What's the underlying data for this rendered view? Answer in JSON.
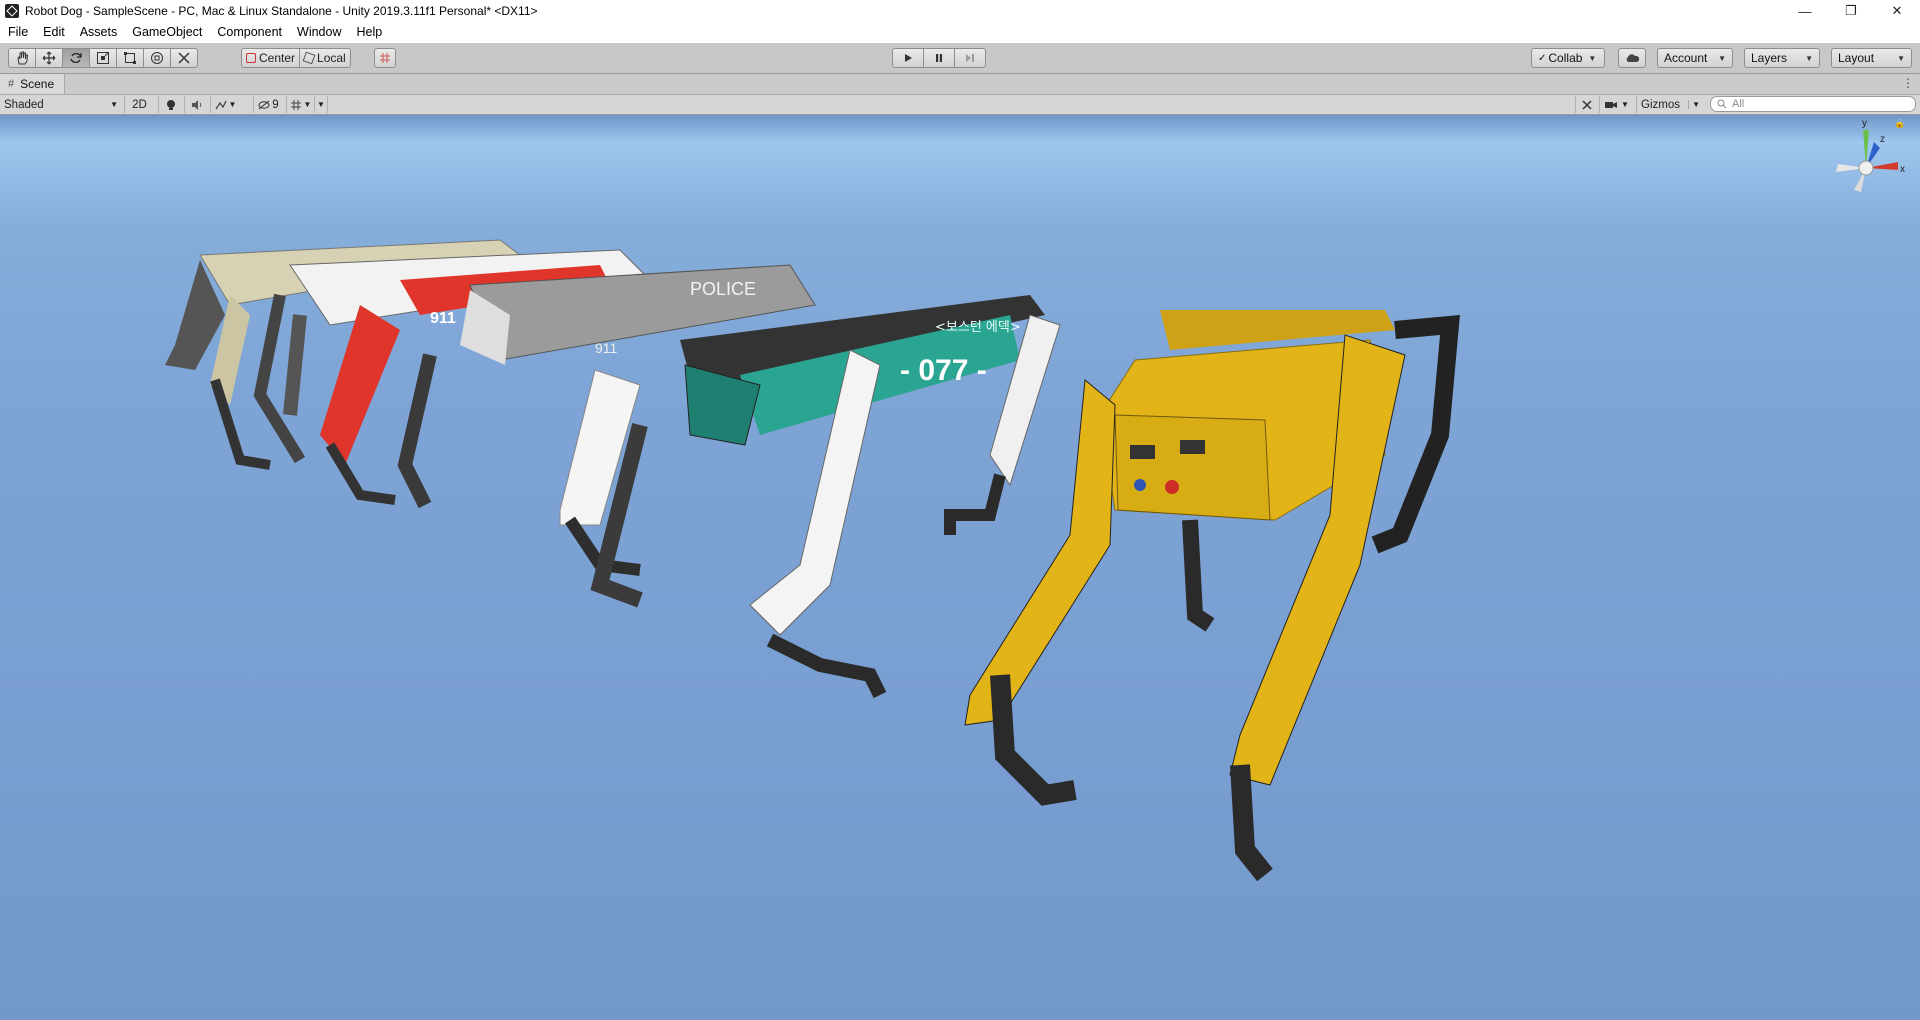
{
  "window": {
    "title": "Robot Dog - SampleScene - PC, Mac & Linux Standalone - Unity 2019.3.11f1 Personal* <DX11>",
    "controls": {
      "minimize": "—",
      "maximize": "❐",
      "close": "✕"
    }
  },
  "menu": [
    "File",
    "Edit",
    "Assets",
    "GameObject",
    "Component",
    "Window",
    "Help"
  ],
  "toolbar": {
    "pivot_label": "Center",
    "space_label": "Local",
    "collab_label": "Collab",
    "account_label": "Account",
    "layers_label": "Layers",
    "layout_label": "Layout"
  },
  "scene": {
    "tab_label": "Scene",
    "shading_mode": "Shaded",
    "mode_2d": "2D",
    "hidden_count": "9",
    "gizmos_label": "Gizmos",
    "search_placeholder": "All"
  },
  "scene_content": {
    "decal_police": "POLICE",
    "decal_number": "- 077 -",
    "decal_korean": "<보스턴 에덱>",
    "decal_911": "911"
  },
  "gizmo_axes": {
    "y": "y",
    "z": "z",
    "x": "x"
  },
  "colors": {
    "accent_yellow": "#e2b417",
    "accent_red": "#e0352a",
    "accent_teal": "#2aa592",
    "sky_blue": "#7ea5d6"
  }
}
